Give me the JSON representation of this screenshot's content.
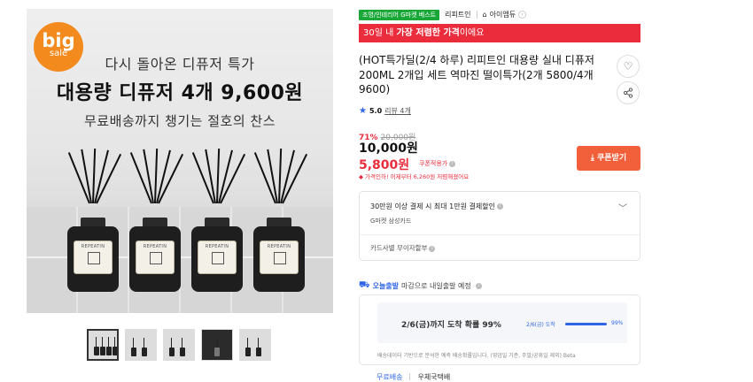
{
  "hero": {
    "badge_big": "big",
    "badge_small": "sale",
    "line1": "다시 돌아온 디퓨저 특가",
    "line2": "대용량 디퓨저 4개 9,600원",
    "line3": "무료배송까지 챙기는 절호의 찬스",
    "bottle_label": "REPEATIN",
    "bottle_count": 4
  },
  "thumbnails": [
    {
      "name": "thumb-1",
      "active": true
    },
    {
      "name": "thumb-2",
      "active": false
    },
    {
      "name": "thumb-3",
      "active": false
    },
    {
      "name": "thumb-4",
      "active": false
    },
    {
      "name": "thumb-5",
      "active": false
    }
  ],
  "tags": {
    "category": "조명/인테리어 G마켓 베스트",
    "brand": "리피트인",
    "shop": "아이엠듀"
  },
  "promo_bar": {
    "prefix": "30일 내 ",
    "emphasis": "가장 저렴한 가격",
    "suffix": "이에요"
  },
  "product": {
    "title": "(HOT특가딜(2/4 하루) 리피트인 대용량 실내 디퓨저 200ML 2개입 세트 역마진 떨이특가(2개 5800/4개 9600)",
    "rating": "5.0",
    "reviews": "리뷰 4개"
  },
  "price": {
    "discount_pct": "71%",
    "original": "20,000원",
    "sale": "10,000원",
    "coupon_price": "5,800원",
    "coupon_label": "쿠폰적용가",
    "lowest_note": "가격인하! 어제부터 6,260원 저렴해졌어요",
    "coupon_button": "쿠폰받기"
  },
  "card_promo": {
    "title": "30만원 이상 결제 시 최대 1만원 결제할인",
    "card": "G마켓 삼성카드",
    "installment": "카드사별 무이자할부"
  },
  "delivery": {
    "badge": "오늘출발",
    "note": "마감으로 내일출발 예정",
    "estimate": "2/6(금)까지 도착 확률 99%",
    "day_label": "2/6(금) 도착",
    "percent_label": "99%",
    "percent_value": 0.99,
    "disclaimer": "배송데이터 기반으로 분석한 예측 배송확률입니다. (영업일 기준, 주말/공휴일 제외) Beta"
  },
  "shipping": {
    "fee": "무료배송",
    "carrier": "우체국택배"
  },
  "colors": {
    "accent_red": "#ea2c3c",
    "coupon_orange": "#f2603b",
    "link_blue": "#2f66e8",
    "badge_green": "#19a838",
    "sale_orange": "#f28a1e"
  }
}
